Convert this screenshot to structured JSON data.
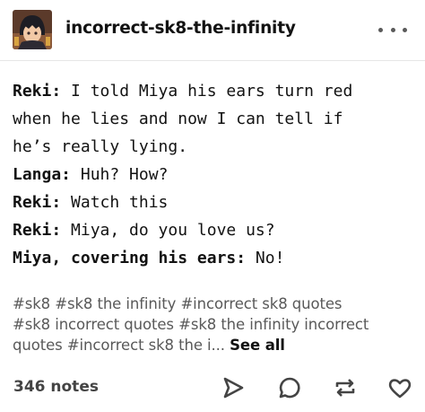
{
  "post": {
    "blog_name": "incorrect-sk8-the-infinity",
    "lines": [
      {
        "speaker": "Reki:",
        "text": " I told Miya his ears turn red"
      },
      {
        "speaker": "",
        "text": "when he lies and now I can tell if"
      },
      {
        "speaker": "",
        "text": "he’s really lying."
      },
      {
        "speaker": "Langa:",
        "text": " Huh? How?"
      },
      {
        "speaker": "Reki:",
        "text": " Watch this"
      },
      {
        "speaker": "Reki:",
        "text": " Miya, do you love us?"
      },
      {
        "speaker": "Miya, covering his ears:",
        "text": " No!"
      }
    ],
    "tags": [
      "#sk8",
      "#sk8 the infinity",
      "#incorrect sk8 quotes",
      "#sk8 incorrect quotes",
      "#sk8 the infinity incorrect quotes",
      "#incorrect sk8 the i..."
    ],
    "see_all_label": "See all",
    "notes_label": "346 notes",
    "icons": {
      "more": "more-horizontal-icon",
      "share": "share-send-icon",
      "reply": "reply-bubble-icon",
      "reblog": "reblog-icon",
      "like": "heart-icon"
    }
  }
}
